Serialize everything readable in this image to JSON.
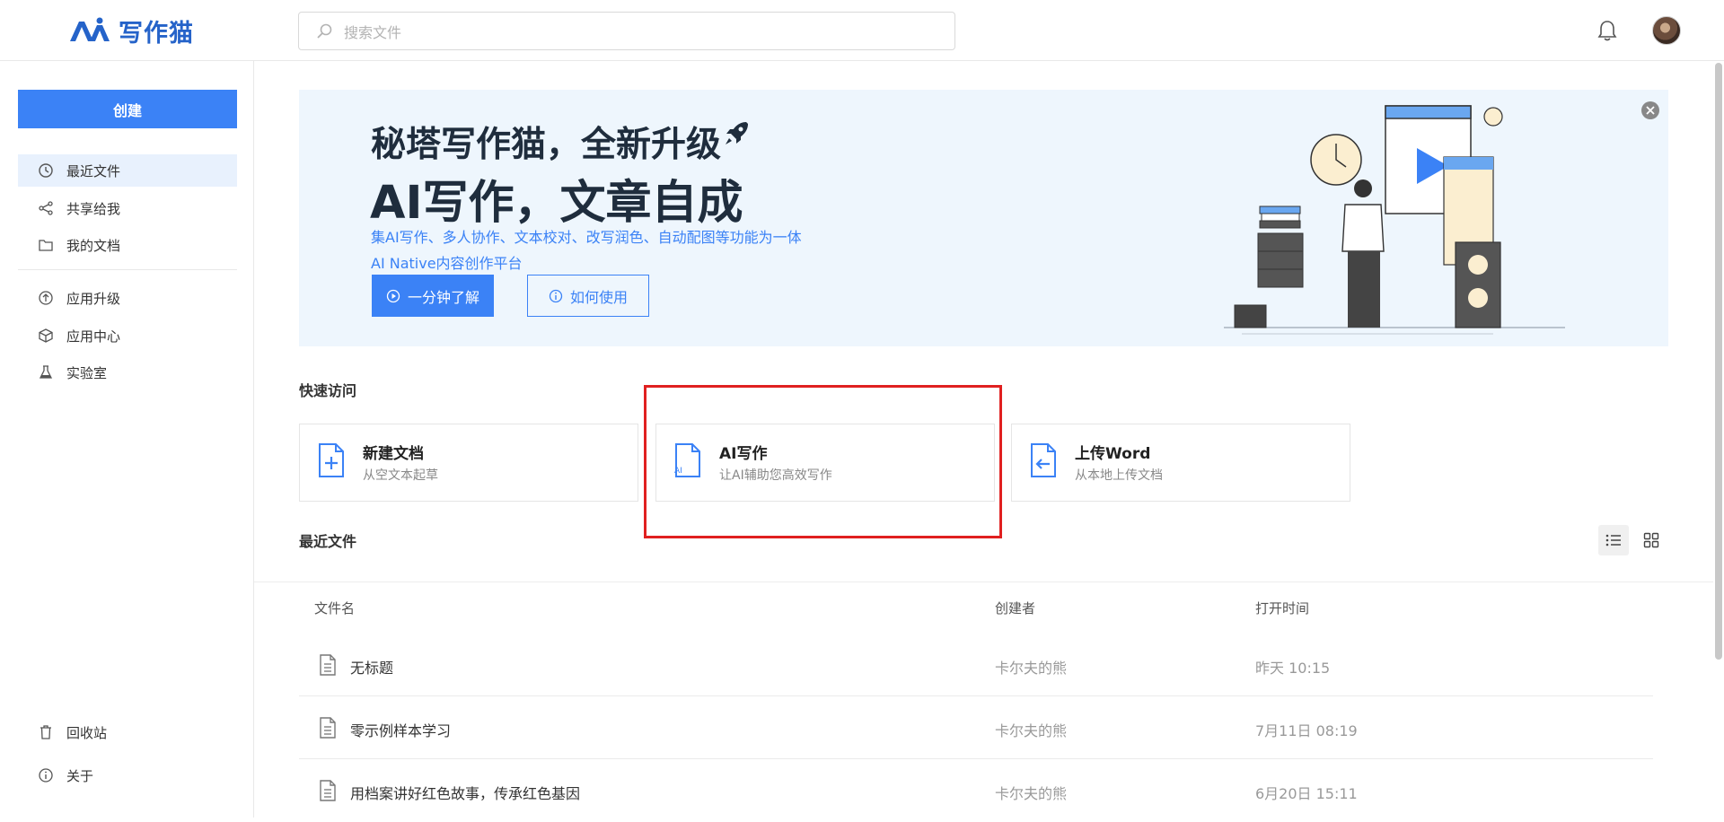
{
  "header": {
    "logo_text": "写作猫",
    "search_placeholder": "搜索文件"
  },
  "sidebar": {
    "create_label": "创建",
    "items": [
      {
        "label": "最近文件",
        "icon": "clock-icon",
        "active": true
      },
      {
        "label": "共享给我",
        "icon": "share-icon"
      },
      {
        "label": "我的文档",
        "icon": "folder-icon"
      },
      {
        "label": "应用升级",
        "icon": "upgrade-icon"
      },
      {
        "label": "应用中心",
        "icon": "cube-icon"
      },
      {
        "label": "实验室",
        "icon": "flask-icon"
      }
    ],
    "bottom_items": [
      {
        "label": "回收站",
        "icon": "trash-icon"
      },
      {
        "label": "关于",
        "icon": "info-icon"
      }
    ]
  },
  "banner": {
    "title1": "秘塔写作猫，全新升级",
    "title2": "AI写作，文章自成",
    "subtitle1": "集AI写作、多人协作、文本校对、改写润色、自动配图等功能为一体",
    "subtitle2": "AI Native内容创作平台",
    "btn_primary": "一分钟了解",
    "btn_secondary": "如何使用"
  },
  "quick_access": {
    "title": "快速访问",
    "cards": [
      {
        "title": "新建文档",
        "desc": "从空文本起草",
        "icon": "new-doc-icon"
      },
      {
        "title": "AI写作",
        "desc": "让AI辅助您高效写作",
        "icon": "ai-doc-icon"
      },
      {
        "title": "上传Word",
        "desc": "从本地上传文档",
        "icon": "upload-doc-icon"
      }
    ]
  },
  "recent": {
    "title": "最近文件",
    "columns": {
      "name": "文件名",
      "creator": "创建者",
      "time": "打开时间"
    },
    "rows": [
      {
        "name": "无标题",
        "creator": "卡尔夫的熊",
        "time": "昨天 10:15"
      },
      {
        "name": "零示例样本学习",
        "creator": "卡尔夫的熊",
        "time": "7月11日 08:19"
      },
      {
        "name": "用档案讲好红色故事，传承红色基因",
        "creator": "卡尔夫的熊",
        "time": "6月20日 15:11"
      }
    ]
  },
  "colors": {
    "accent": "#3b82f6",
    "brand": "#2563c9",
    "highlight_box": "#e02020",
    "banner_bg": "#eef6fd"
  }
}
